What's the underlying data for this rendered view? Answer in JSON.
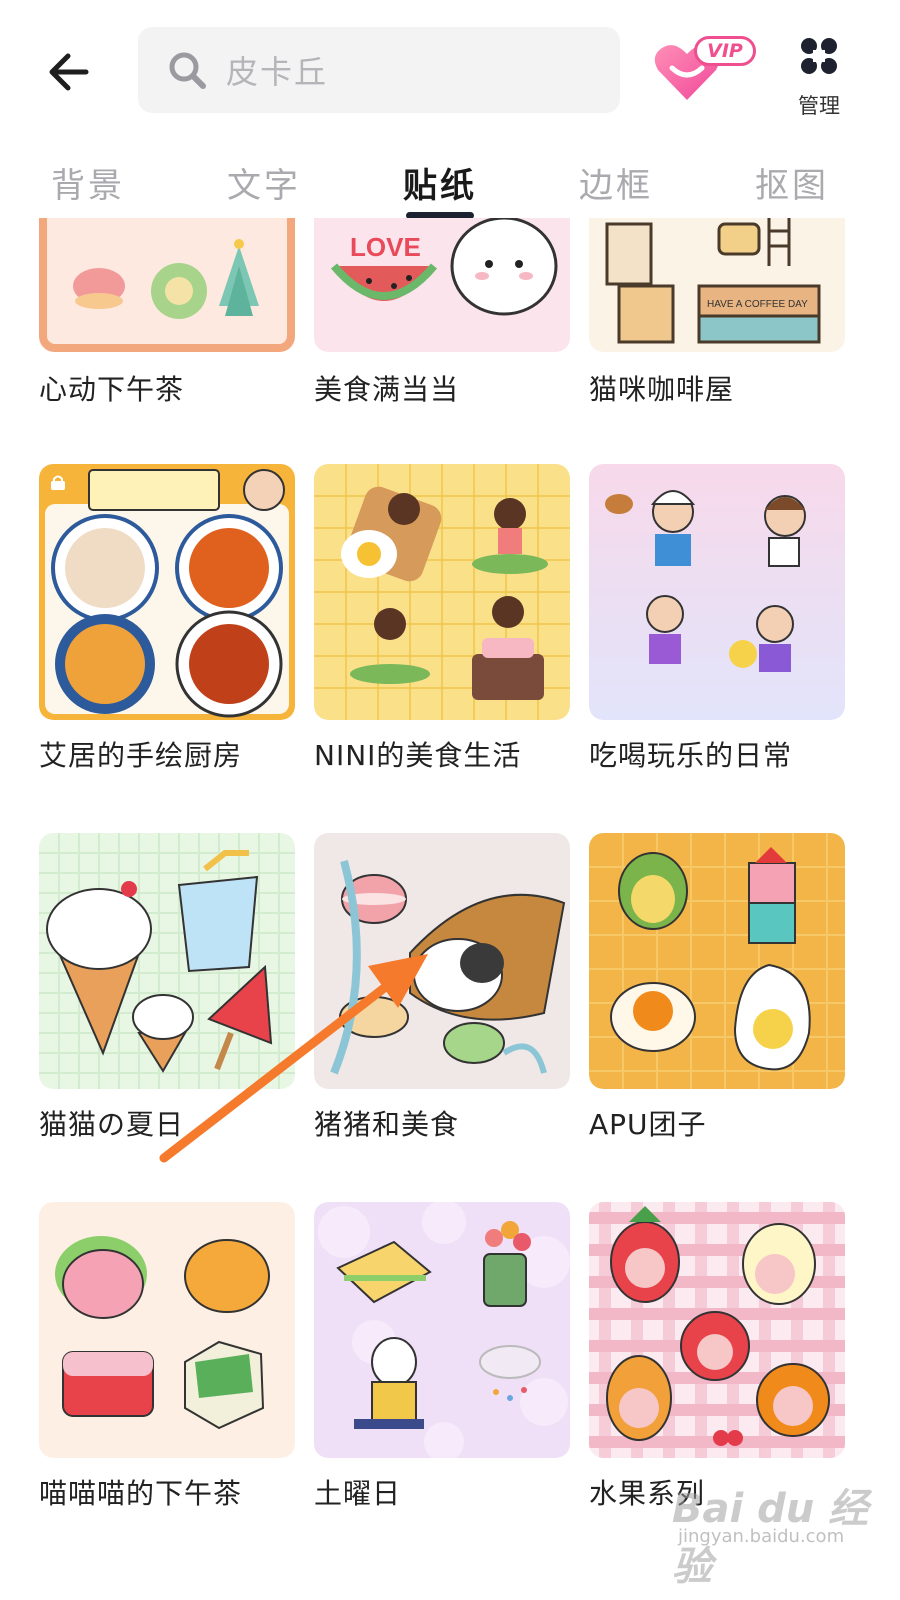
{
  "header": {
    "search_placeholder": "皮卡丘",
    "vip_badge": "VIP",
    "manage_label": "管理"
  },
  "tabs": [
    {
      "label": "背景",
      "active": false
    },
    {
      "label": "文字",
      "active": false
    },
    {
      "label": "贴纸",
      "active": true
    },
    {
      "label": "边框",
      "active": false
    },
    {
      "label": "抠图",
      "active": false
    }
  ],
  "sticker_packs": [
    {
      "title": "心动下午茶",
      "thumb_bg": "#fde9df",
      "thumb_accent": "#f3a77d"
    },
    {
      "title": "美食满当当",
      "thumb_bg": "#fbe4ec",
      "thumb_accent": "#e25a5a"
    },
    {
      "title": "猫咪咖啡屋",
      "thumb_bg": "#fbf3e6",
      "thumb_accent": "#5a4a3a"
    },
    {
      "title": "艾居的手绘厨房",
      "thumb_bg": "#f7b43a",
      "thumb_accent": "#e0601e",
      "locked": true
    },
    {
      "title": "NINI的美食生活",
      "thumb_bg": "#fbe08a",
      "thumb_accent": "#f0c64a"
    },
    {
      "title": "吃喝玩乐的日常",
      "thumb_bg": "#e9e3fb",
      "thumb_accent": "#f4d3e6"
    },
    {
      "title": "猫猫の夏日",
      "thumb_bg": "#e8f6e4",
      "thumb_accent": "#f2c6c6"
    },
    {
      "title": "猪猪和美食",
      "thumb_bg": "#f0e8e6",
      "thumb_accent": "#c6883e"
    },
    {
      "title": "APU团子",
      "thumb_bg": "#f4b548",
      "thumb_accent": "#f7c868"
    },
    {
      "title": "喵喵喵的下午茶",
      "thumb_bg": "#fdefe3",
      "thumb_accent": "#f5a3b4"
    },
    {
      "title": "土曜日",
      "thumb_bg": "#efe0f7",
      "thumb_accent": "#f7d46c"
    },
    {
      "title": "水果系列",
      "thumb_bg": "#fbeaf0",
      "thumb_accent": "#e55a7a"
    }
  ],
  "overlay": {
    "arrow_color": "#f57a2c"
  },
  "watermark": {
    "brand": "Bai du 经验",
    "url": "jingyan.baidu.com"
  }
}
